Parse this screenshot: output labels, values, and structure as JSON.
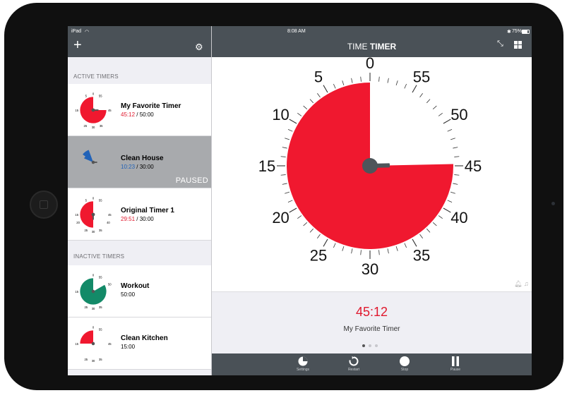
{
  "status_bar": {
    "device": "iPad",
    "time": "8:08 AM",
    "battery": "75%"
  },
  "app": {
    "title_light": "TIME",
    "title_bold": "TIMER"
  },
  "sidebar": {
    "active_label": "ACTIVE TIMERS",
    "inactive_label": "INACTIVE TIMERS",
    "active": [
      {
        "name": "My Favorite Timer",
        "remaining": "45:12",
        "total": " / 50:00"
      },
      {
        "name": "Clean House",
        "remaining": "10:23",
        "total": " / 30:00",
        "state": "PAUSED"
      },
      {
        "name": "Original Timer 1",
        "remaining": "29:51",
        "total": " / 30:00"
      }
    ],
    "inactive": [
      {
        "name": "Workout",
        "total": "50:00"
      },
      {
        "name": "Clean Kitchen",
        "total": "15:00"
      }
    ]
  },
  "dial": {
    "labels": [
      "0",
      "5",
      "10",
      "15",
      "20",
      "25",
      "30",
      "35",
      "40",
      "45",
      "50",
      "55"
    ],
    "remaining_minutes": 45.2,
    "color": "#f0182f"
  },
  "current": {
    "time": "45:12",
    "name": "My Favorite Timer"
  },
  "toolbar": {
    "settings": "Settings",
    "restart": "Restart",
    "stop": "Stop",
    "pause": "Pause"
  },
  "colors": {
    "bar": "#4a5157",
    "red": "#f0182f",
    "blue": "#2263b8",
    "green": "#138a68"
  }
}
